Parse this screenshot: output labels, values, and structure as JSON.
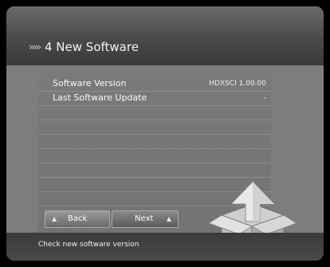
{
  "header": {
    "chevrons": "›››››",
    "title": "4 New Software"
  },
  "info": {
    "rows": [
      {
        "label": "Software Version",
        "value": "HDXSCI 1.00.00"
      },
      {
        "label": "Last Software Update",
        "value": "-"
      }
    ]
  },
  "buttons": {
    "back_label": "Back",
    "next_label": "Next"
  },
  "status": {
    "text": "Check new software version"
  },
  "icons": {
    "back": "up-triangle-icon",
    "next": "up-triangle-icon",
    "graphic": "software-update-box-icon"
  },
  "colors": {
    "header": "#4a4a4a",
    "panel": "#777777",
    "screen": "#7d7d7d",
    "footer": "#3d3d3d"
  }
}
